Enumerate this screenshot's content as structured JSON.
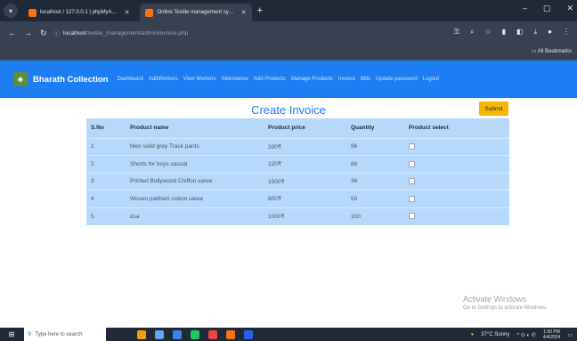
{
  "browser": {
    "tabs": [
      {
        "label": "localhost / 127.0.0.1 | phpMyA…",
        "favicon_color": "#f97316"
      },
      {
        "label": "Online Textile management sy…",
        "favicon_color": "#f97316"
      }
    ],
    "url_host": "localhost",
    "url_path": "/textile_management/admin/invoice.php",
    "bookmarks_label": "All Bookmarks"
  },
  "navbar": {
    "brand": "Bharath Collection",
    "links": [
      "Dashboard",
      "AddWorkers",
      "View Workers",
      "Attendance",
      "Add Products",
      "Manage Products",
      "Invoice",
      "Bills",
      "Update password",
      "Logout"
    ]
  },
  "page": {
    "title": "Create Invoice",
    "submit_label": "Submit"
  },
  "table": {
    "headers": [
      "S.No",
      "Product name",
      "Product price",
      "Quantity",
      "Product select"
    ],
    "rows": [
      [
        "1",
        "Men solid grey Track pants",
        "200₹",
        "96"
      ],
      [
        "2",
        "Shorts for boys casual",
        "120₹",
        "66"
      ],
      [
        "3",
        "Printed Bollywood Chiffon saree",
        "1500₹",
        "36"
      ],
      [
        "4",
        "Woven paithani cotton saree",
        "800₹",
        "50"
      ],
      [
        "5",
        "dsa",
        "1000₹",
        "100"
      ]
    ]
  },
  "watermark": {
    "line1": "Activate Windows",
    "line2": "Go to Settings to activate Windows."
  },
  "taskbar": {
    "search_placeholder": "Type here to search",
    "weather": "37°C  Sunny",
    "time": "1:50 PM",
    "date": "4/4/2024"
  }
}
